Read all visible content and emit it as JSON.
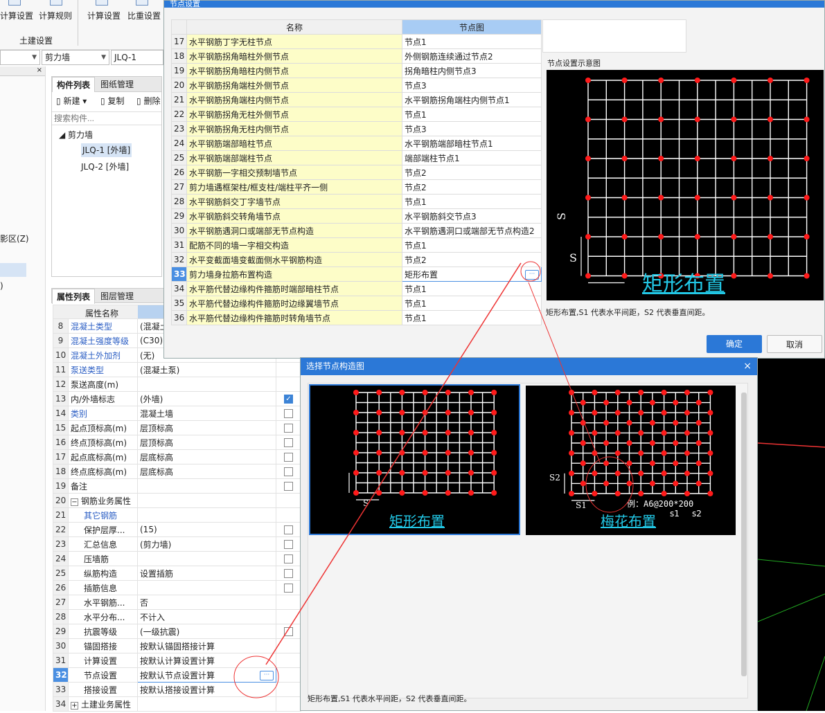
{
  "ribbon": {
    "btn1": "计算设置",
    "btn2": "计算规则",
    "btn3": "计算设置",
    "btn4": "比重设置",
    "group": "土建设置"
  },
  "combos": {
    "c1": "剪力墙",
    "c2": "JLQ-1"
  },
  "left": {
    "label_z": "影区(Z)",
    "label_paren": ")"
  },
  "comp": {
    "tab1": "构件列表",
    "tab2": "图纸管理",
    "new": "新建",
    "copy": "复制",
    "delete": "删除",
    "search": "搜索构件...",
    "group": "剪力墙",
    "items": [
      "JLQ-1 [外墙]",
      "JLQ-2 [外墙]"
    ]
  },
  "props": {
    "tab1": "属性列表",
    "tab2": "图层管理",
    "header": "属性名称",
    "rows": [
      {
        "no": "8",
        "name": "混凝土类型",
        "val": "(混凝土",
        "blue": true
      },
      {
        "no": "9",
        "name": "混凝土强度等级",
        "val": "(C30)",
        "blue": true
      },
      {
        "no": "10",
        "name": "混凝土外加剂",
        "val": "(无)",
        "blue": true
      },
      {
        "no": "11",
        "name": "泵送类型",
        "val": "(混凝土泵)",
        "blue": true
      },
      {
        "no": "12",
        "name": "泵送高度(m)",
        "val": ""
      },
      {
        "no": "13",
        "name": "内/外墙标志",
        "val": "(外墙)",
        "cb": "on"
      },
      {
        "no": "14",
        "name": "类别",
        "val": "混凝土墙",
        "blue": true,
        "cb": "off"
      },
      {
        "no": "15",
        "name": "起点顶标高(m)",
        "val": "层顶标高",
        "cb": "off"
      },
      {
        "no": "16",
        "name": "终点顶标高(m)",
        "val": "层顶标高",
        "cb": "off"
      },
      {
        "no": "17",
        "name": "起点底标高(m)",
        "val": "层底标高",
        "cb": "off"
      },
      {
        "no": "18",
        "name": "终点底标高(m)",
        "val": "层底标高",
        "cb": "off"
      },
      {
        "no": "19",
        "name": "备注",
        "val": "",
        "cb": "off"
      },
      {
        "no": "20",
        "name": "钢筋业务属性",
        "val": "",
        "exp": "−"
      },
      {
        "no": "21",
        "name": "其它钢筋",
        "val": "",
        "blue": true,
        "ind": true
      },
      {
        "no": "22",
        "name": "保护层厚...",
        "val": "(15)",
        "ind": true,
        "cb": "off"
      },
      {
        "no": "23",
        "name": "汇总信息",
        "val": "(剪力墙)",
        "ind": true,
        "cb": "off"
      },
      {
        "no": "24",
        "name": "压墙筋",
        "val": "",
        "ind": true,
        "cb": "off"
      },
      {
        "no": "25",
        "name": "纵筋构造",
        "val": "设置插筋",
        "ind": true,
        "cb": "off"
      },
      {
        "no": "26",
        "name": "插筋信息",
        "val": "",
        "ind": true,
        "cb": "off"
      },
      {
        "no": "27",
        "name": "水平钢筋...",
        "val": "否",
        "ind": true
      },
      {
        "no": "28",
        "name": "水平分布...",
        "val": "不计入",
        "ind": true
      },
      {
        "no": "29",
        "name": "抗震等级",
        "val": "(一级抗震)",
        "ind": true,
        "cb": "off"
      },
      {
        "no": "30",
        "name": "锚固搭接",
        "val": "按默认锚固搭接计算",
        "ind": true
      },
      {
        "no": "31",
        "name": "计算设置",
        "val": "按默认计算设置计算",
        "ind": true
      },
      {
        "no": "32",
        "name": "节点设置",
        "val": "按默认节点设置计算",
        "ind": true,
        "cur": true
      },
      {
        "no": "33",
        "name": "搭接设置",
        "val": "按默认搭接设置计算",
        "ind": true
      },
      {
        "no": "34",
        "name": "土建业务属性",
        "val": "",
        "exp": "+"
      }
    ]
  },
  "dlg1": {
    "title": "节点设置",
    "col_name": "名称",
    "col_fig": "节点图",
    "preview_label": "节点设置示意图",
    "fig_title": "矩形布置",
    "fig_s": "S",
    "note": "矩形布置,S1 代表水平间距，S2 代表垂直间距。",
    "ok": "确定",
    "cancel": "取消",
    "rows": [
      {
        "no": "17",
        "name": "水平钢筋丁字无柱节点",
        "val": "节点1"
      },
      {
        "no": "18",
        "name": "水平钢筋拐角暗柱外侧节点",
        "val": "外侧钢筋连续通过节点2"
      },
      {
        "no": "19",
        "name": "水平钢筋拐角暗柱内侧节点",
        "val": "拐角暗柱内侧节点3"
      },
      {
        "no": "20",
        "name": "水平钢筋拐角端柱外侧节点",
        "val": "节点3"
      },
      {
        "no": "21",
        "name": "水平钢筋拐角端柱内侧节点",
        "val": "水平钢筋拐角端柱内侧节点1"
      },
      {
        "no": "22",
        "name": "水平钢筋拐角无柱外侧节点",
        "val": "节点1"
      },
      {
        "no": "23",
        "name": "水平钢筋拐角无柱内侧节点",
        "val": "节点3"
      },
      {
        "no": "24",
        "name": "水平钢筋端部暗柱节点",
        "val": "水平钢筋端部暗柱节点1"
      },
      {
        "no": "25",
        "name": "水平钢筋端部端柱节点",
        "val": "端部端柱节点1"
      },
      {
        "no": "26",
        "name": "水平钢筋一字相交预制墙节点",
        "val": "节点2"
      },
      {
        "no": "27",
        "name": "剪力墙遇框架柱/框支柱/端柱平齐一侧",
        "val": "节点2"
      },
      {
        "no": "28",
        "name": "水平钢筋斜交丁字墙节点",
        "val": "节点1"
      },
      {
        "no": "29",
        "name": "水平钢筋斜交转角墙节点",
        "val": "水平钢筋斜交节点3"
      },
      {
        "no": "30",
        "name": "水平钢筋遇洞口或端部无节点构造",
        "val": "水平钢筋遇洞口或端部无节点构造2"
      },
      {
        "no": "31",
        "name": "配筋不同的墙一字相交构造",
        "val": "节点1"
      },
      {
        "no": "32",
        "name": "水平变截面墙变截面侧水平钢筋构造",
        "val": "节点2"
      },
      {
        "no": "33",
        "name": "剪力墙身拉筋布置构造",
        "val": "矩形布置",
        "cur": true
      },
      {
        "no": "34",
        "name": "水平筋代替边缘构件箍筋时端部暗柱节点",
        "val": "节点1"
      },
      {
        "no": "35",
        "name": "水平筋代替边缘构件箍筋时边缘翼墙节点",
        "val": "节点1"
      },
      {
        "no": "36",
        "name": "水平筋代替边缘构件箍筋时转角墙节点",
        "val": "节点1"
      }
    ]
  },
  "dlg2": {
    "title": "选择节点构造图",
    "opt1": "矩形布置",
    "opt2": "梅花布置",
    "s": "S",
    "s1": "S1",
    "s2": "S2",
    "example": "例：A6@200*200",
    "ex_s1": "s1",
    "ex_s2": "s2",
    "note": "矩形布置,S1 代表水平间距，S2 代表垂直间距。"
  },
  "colors": {
    "accent": "#2b78d7",
    "dot": "#ff1a1a",
    "caption": "#22c8e6",
    "annotation": "#e33"
  }
}
